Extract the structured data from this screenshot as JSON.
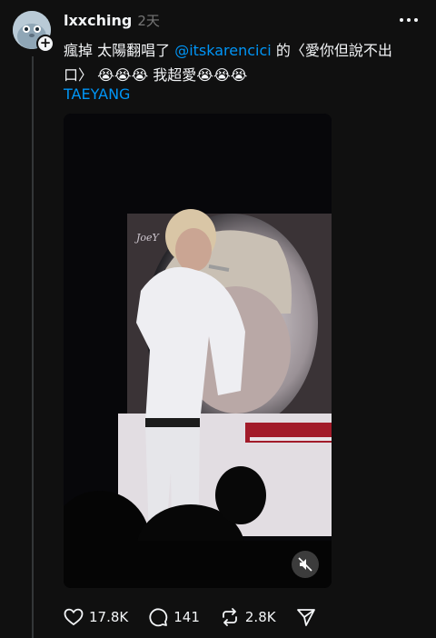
{
  "post": {
    "username": "lxxching",
    "timestamp": "2天",
    "text_line1_a": "瘋掉 太陽翻唱了 ",
    "mention": "@itskarencici",
    "text_line1_b": " 的〈愛你但說不出",
    "text_line2": "口〉 😭😭😭 我超愛😭😭😭",
    "hashtag": "TAEYANG",
    "watermark": "JoeY"
  },
  "actions": {
    "likes": "17.8K",
    "comments": "141",
    "reposts": "2.8K"
  },
  "icons": [
    "plus-icon",
    "more-icon",
    "mute-icon",
    "heart-icon",
    "comment-icon",
    "repost-icon",
    "share-icon"
  ],
  "colors": {
    "background": "#101010",
    "link": "#0095f6",
    "text": "#f3f5f7",
    "muted": "#777777"
  }
}
